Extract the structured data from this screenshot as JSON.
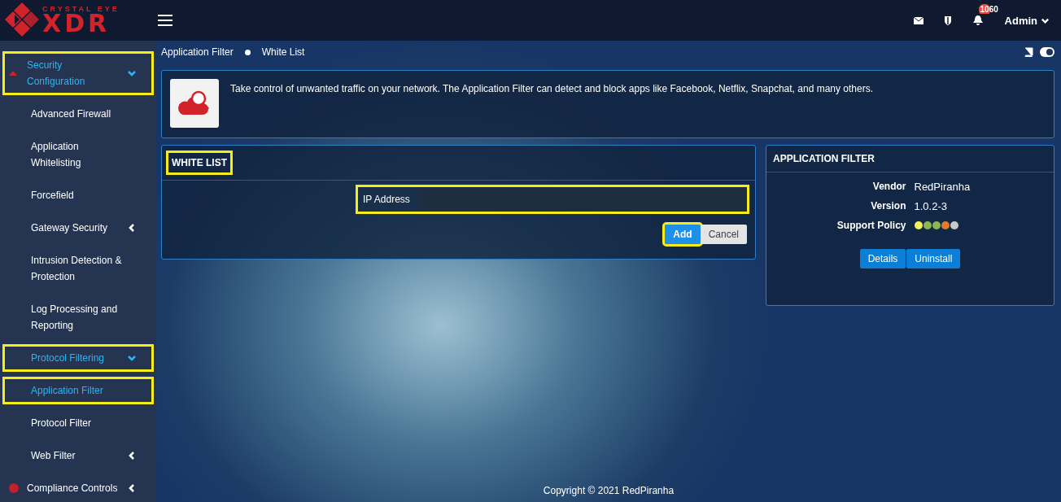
{
  "logo": {
    "tagline": "CRYSTAL EYE",
    "wordmark": "XDR"
  },
  "topbar": {
    "notification_count": "1060",
    "user": "Admin"
  },
  "sidebar": {
    "items": [
      {
        "label": "Security Configuration",
        "selected": true,
        "expanded": true,
        "highlighted": true,
        "children": [
          {
            "label": "Advanced Firewall",
            "selected": false,
            "highlighted": false
          },
          {
            "label": "Application Whitelisting",
            "selected": false,
            "highlighted": false
          },
          {
            "label": "Forcefield",
            "selected": false,
            "highlighted": false
          },
          {
            "label": "Gateway Security",
            "selected": false,
            "expanded": false,
            "highlighted": false
          },
          {
            "label": "Intrusion Detection & Protection",
            "selected": false,
            "highlighted": false
          },
          {
            "label": "Log Processing and Reporting",
            "selected": false,
            "highlighted": false
          },
          {
            "label": "Protocol Filtering",
            "selected": true,
            "expanded": true,
            "highlighted": true,
            "children": [
              {
                "label": "Application Filter",
                "selected": true,
                "highlighted": true
              },
              {
                "label": "Protocol Filter",
                "selected": false,
                "highlighted": false
              }
            ]
          },
          {
            "label": "Web Filter",
            "selected": false,
            "expanded": false,
            "highlighted": false
          }
        ]
      },
      {
        "label": "Compliance Controls",
        "selected": false,
        "expanded": false,
        "highlighted": false
      }
    ]
  },
  "breadcrumb": [
    "Application Filter",
    "White List"
  ],
  "info": {
    "text": "Take control of unwanted traffic on your network. The Application Filter can detect and block apps like Facebook, Netflix, Snapchat, and many others."
  },
  "white_list": {
    "title": "WHITE LIST",
    "title_highlighted": true,
    "field": {
      "label": "IP Address",
      "highlighted": true
    },
    "buttons": [
      {
        "label": "Add",
        "kind": "primary",
        "highlighted": true
      },
      {
        "label": "Cancel",
        "kind": "secondary",
        "highlighted": false
      }
    ]
  },
  "app_panel": {
    "title": "APPLICATION FILTER",
    "rows": [
      {
        "label": "Vendor",
        "value": "RedPiranha"
      },
      {
        "label": "Version",
        "value": "1.0.2-3"
      }
    ],
    "support_policy": {
      "label": "Support Policy",
      "dots": [
        {
          "color": "#f4f25a"
        },
        {
          "color": "#8db552"
        },
        {
          "color": "#8db552"
        },
        {
          "color": "#e07b2e"
        },
        {
          "color": "#c8c8c8"
        }
      ]
    },
    "buttons": [
      "Details",
      "Uninstall"
    ]
  },
  "footer": "Copyright © 2021 RedPiranha"
}
